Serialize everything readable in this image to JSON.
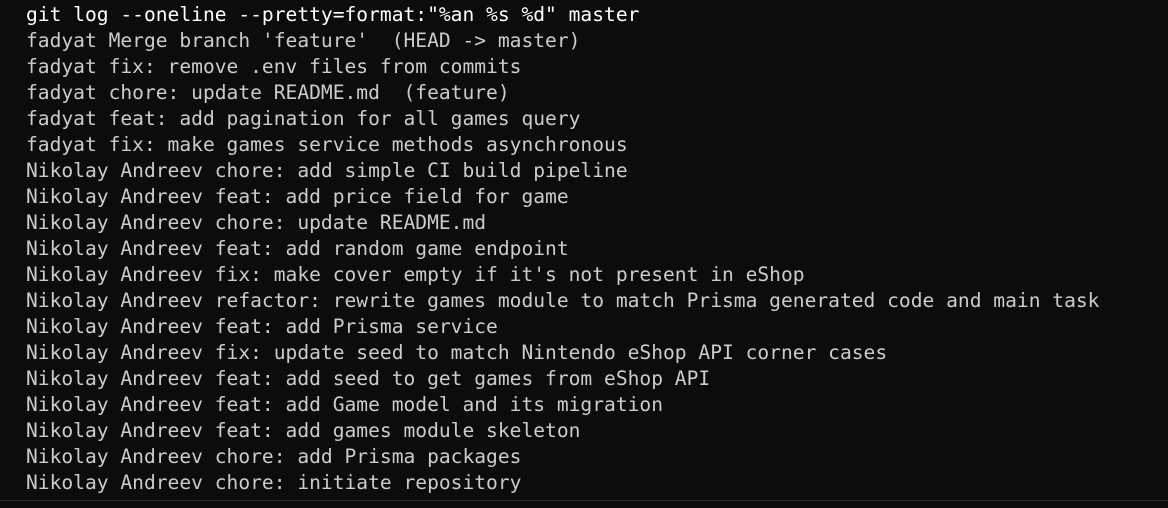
{
  "terminal": {
    "colors": {
      "background": "#0c0c0c",
      "command_text": "#ffffff",
      "output_text": "#cccccc"
    },
    "command": "git log --oneline --pretty=format:\"%an %s %d\" master",
    "lines": [
      "fadyat Merge branch 'feature'  (HEAD -> master)",
      "fadyat fix: remove .env files from commits",
      "fadyat chore: update README.md  (feature)",
      "fadyat feat: add pagination for all games query",
      "fadyat fix: make games service methods asynchronous",
      "Nikolay Andreev chore: add simple CI build pipeline",
      "Nikolay Andreev feat: add price field for game",
      "Nikolay Andreev chore: update README.md",
      "Nikolay Andreev feat: add random game endpoint",
      "Nikolay Andreev fix: make cover empty if it's not present in eShop",
      "Nikolay Andreev refactor: rewrite games module to match Prisma generated code and main task",
      "Nikolay Andreev feat: add Prisma service",
      "Nikolay Andreev fix: update seed to match Nintendo eShop API corner cases",
      "Nikolay Andreev feat: add seed to get games from eShop API",
      "Nikolay Andreev feat: add Game model and its migration",
      "Nikolay Andreev feat: add games module skeleton",
      "Nikolay Andreev chore: add Prisma packages",
      "Nikolay Andreev chore: initiate repository"
    ]
  }
}
